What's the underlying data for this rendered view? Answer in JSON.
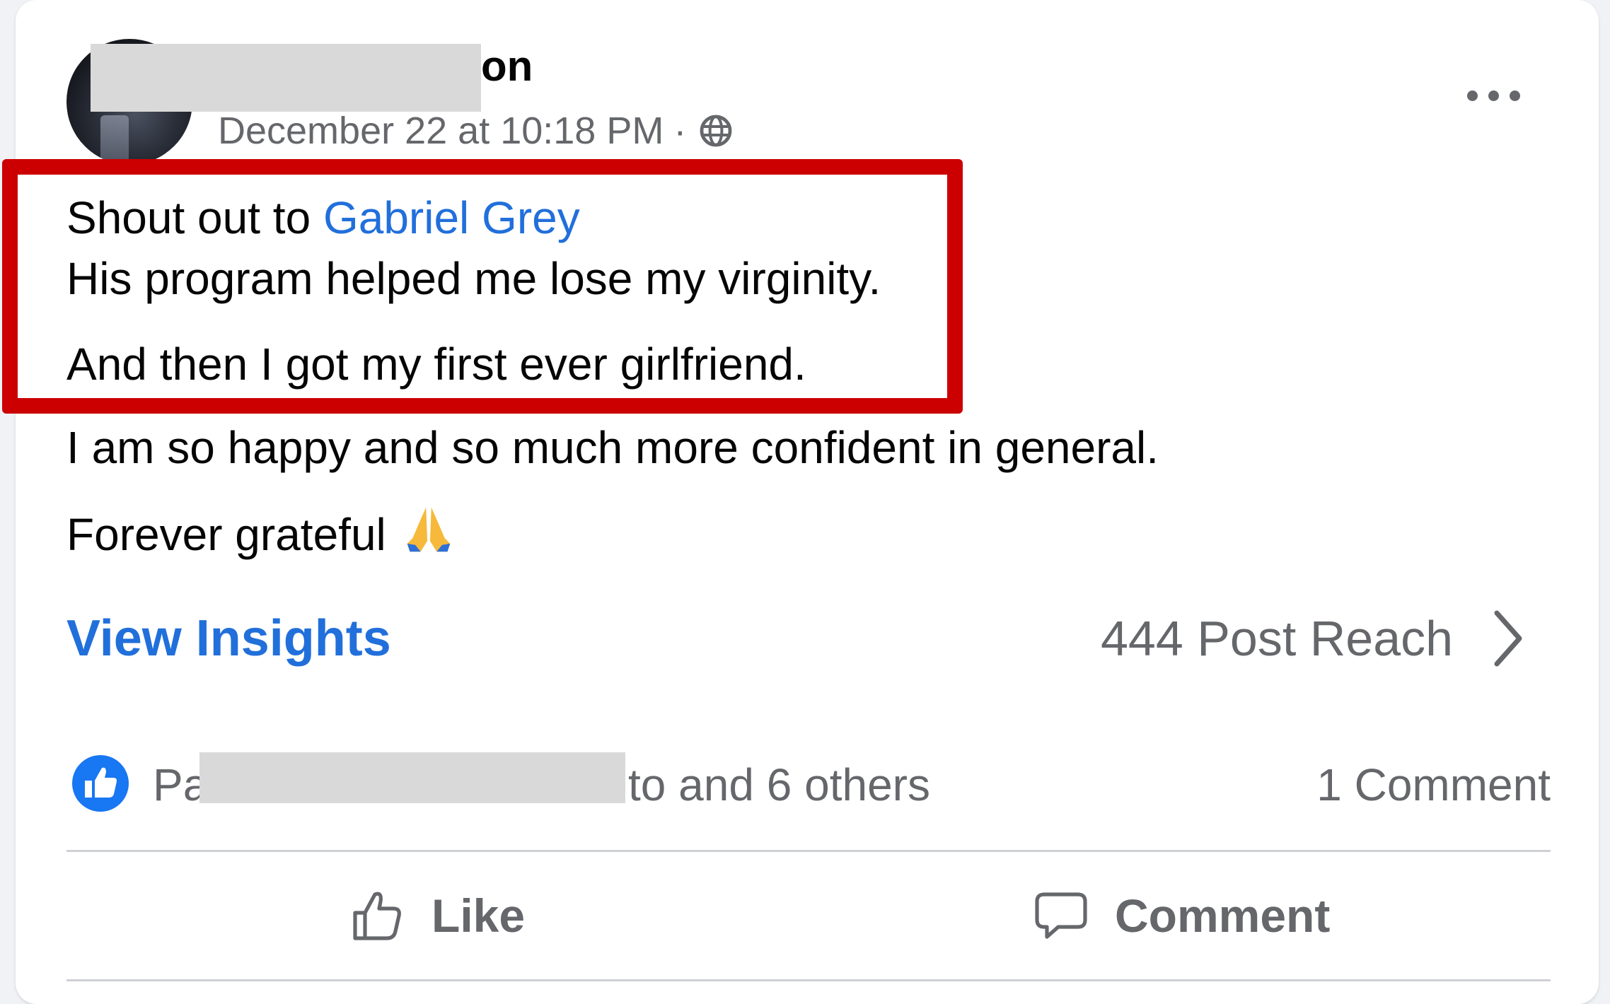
{
  "post": {
    "author_name_visible": "on",
    "timestamp": "December 22 at 10:18 PM",
    "separator": "·",
    "privacy_icon": "globe-icon",
    "more_icon": "more-options-icon",
    "lines": {
      "shout_prefix": "Shout out to ",
      "mention": "Gabriel Grey",
      "line2": "His program helped me lose my virginity.",
      "line3": "And then I got my first ever girlfriend.",
      "line4": "I am so happy and so much more confident in general.",
      "line5": "Forever grateful"
    },
    "emoji_icon": "folded-hands-icon"
  },
  "insights": {
    "link_label": "View Insights",
    "reach_label": "444 Post Reach",
    "chevron_icon": "chevron-right-icon"
  },
  "reactions": {
    "icon": "like-reaction-icon",
    "reactors_prefix": "Pa",
    "reactors_suffix": "to and 6 others",
    "comment_count": "1 Comment"
  },
  "actions": {
    "like_label": "Like",
    "like_icon": "thumbs-up-icon",
    "comment_label": "Comment",
    "comment_icon": "speech-bubble-icon"
  },
  "colors": {
    "link_blue": "#216fdb",
    "highlight_red": "#cc0000",
    "secondary_text": "#65676b",
    "primary_text": "#050505"
  }
}
